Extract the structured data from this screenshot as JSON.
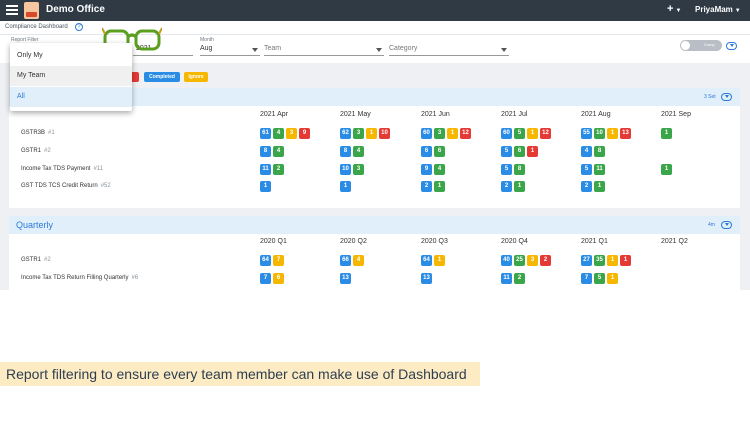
{
  "topbar": {
    "menu_icon": "hamburger-icon",
    "logo_icon": "app-logo-icon",
    "app_title": "Demo Office",
    "add_label": "+",
    "user_name": "PriyaMam"
  },
  "subbar": {
    "breadcrumb": "Compliance Dashboard",
    "help_label": "?"
  },
  "filters": {
    "report_filter_label": "Report Filter",
    "year_value": "2021",
    "month_label": "Month",
    "month_value": "Aug",
    "team_placeholder": "Team",
    "category_placeholder": "Category",
    "toggle_label": "Comp"
  },
  "report_menu": {
    "options": [
      "Only My",
      "My Team",
      "All"
    ],
    "selected": "All"
  },
  "legend": {
    "chips": [
      {
        "label": "",
        "color": "#e53935"
      },
      {
        "label": "Completed",
        "color": "#2a8ce4"
      },
      {
        "label": "Ignore",
        "color": "#f5b700"
      }
    ]
  },
  "monthly": {
    "header_note": "3 Set",
    "columns": [
      "2021 Apr",
      "2021 May",
      "2021 Jun",
      "2021 Jul",
      "2021 Aug",
      "2021 Sep"
    ],
    "rows": [
      {
        "name": "GSTR3B",
        "id": "#1",
        "cells": [
          [
            {
              "v": "61",
              "c": "blue"
            },
            {
              "v": "4",
              "c": "green"
            },
            {
              "v": "3",
              "c": "yellow"
            },
            {
              "v": "9",
              "c": "red"
            }
          ],
          [
            {
              "v": "62",
              "c": "blue"
            },
            {
              "v": "3",
              "c": "green"
            },
            {
              "v": "1",
              "c": "yellow"
            },
            {
              "v": "10",
              "c": "red"
            }
          ],
          [
            {
              "v": "60",
              "c": "blue"
            },
            {
              "v": "3",
              "c": "green"
            },
            {
              "v": "1",
              "c": "yellow"
            },
            {
              "v": "12",
              "c": "red"
            }
          ],
          [
            {
              "v": "60",
              "c": "blue"
            },
            {
              "v": "5",
              "c": "green"
            },
            {
              "v": "1",
              "c": "yellow"
            },
            {
              "v": "12",
              "c": "red"
            }
          ],
          [
            {
              "v": "55",
              "c": "blue"
            },
            {
              "v": "10",
              "c": "green"
            },
            {
              "v": "1",
              "c": "yellow"
            },
            {
              "v": "13",
              "c": "red"
            }
          ],
          [
            {
              "v": "1",
              "c": "green"
            }
          ]
        ]
      },
      {
        "name": "GSTR1",
        "id": "#2",
        "cells": [
          [
            {
              "v": "8",
              "c": "blue"
            },
            {
              "v": "4",
              "c": "green"
            }
          ],
          [
            {
              "v": "8",
              "c": "blue"
            },
            {
              "v": "4",
              "c": "green"
            }
          ],
          [
            {
              "v": "6",
              "c": "blue"
            },
            {
              "v": "6",
              "c": "green"
            }
          ],
          [
            {
              "v": "5",
              "c": "blue"
            },
            {
              "v": "6",
              "c": "green"
            },
            {
              "v": "1",
              "c": "red"
            }
          ],
          [
            {
              "v": "4",
              "c": "blue"
            },
            {
              "v": "8",
              "c": "green"
            }
          ],
          []
        ]
      },
      {
        "name": "Income Tax TDS Payment",
        "id": "#11",
        "cells": [
          [
            {
              "v": "11",
              "c": "blue"
            },
            {
              "v": "2",
              "c": "green"
            }
          ],
          [
            {
              "v": "10",
              "c": "blue"
            },
            {
              "v": "3",
              "c": "green"
            }
          ],
          [
            {
              "v": "9",
              "c": "blue"
            },
            {
              "v": "4",
              "c": "green"
            }
          ],
          [
            {
              "v": "5",
              "c": "blue"
            },
            {
              "v": "8",
              "c": "green"
            }
          ],
          [
            {
              "v": "5",
              "c": "blue"
            },
            {
              "v": "11",
              "c": "green"
            }
          ],
          [
            {
              "v": "1",
              "c": "green"
            }
          ]
        ]
      },
      {
        "name": "GST TDS TCS Credit Return",
        "id": "#52",
        "cells": [
          [
            {
              "v": "1",
              "c": "blue"
            }
          ],
          [
            {
              "v": "1",
              "c": "blue"
            }
          ],
          [
            {
              "v": "2",
              "c": "blue"
            },
            {
              "v": "1",
              "c": "green"
            }
          ],
          [
            {
              "v": "2",
              "c": "blue"
            },
            {
              "v": "1",
              "c": "green"
            }
          ],
          [
            {
              "v": "2",
              "c": "blue"
            },
            {
              "v": "1",
              "c": "green"
            }
          ],
          []
        ]
      }
    ]
  },
  "quarterly": {
    "title": "Quarterly",
    "header_note": "4m",
    "columns": [
      "2020 Q1",
      "2020 Q2",
      "2020 Q3",
      "2020 Q4",
      "2021 Q1",
      "2021 Q2"
    ],
    "rows": [
      {
        "name": "GSTR1",
        "id": "#2",
        "cells": [
          [
            {
              "v": "64",
              "c": "blue"
            },
            {
              "v": "7",
              "c": "yellow"
            }
          ],
          [
            {
              "v": "66",
              "c": "blue"
            },
            {
              "v": "4",
              "c": "yellow"
            }
          ],
          [
            {
              "v": "64",
              "c": "blue"
            },
            {
              "v": "1",
              "c": "yellow"
            }
          ],
          [
            {
              "v": "40",
              "c": "blue"
            },
            {
              "v": "25",
              "c": "green"
            },
            {
              "v": "3",
              "c": "yellow"
            },
            {
              "v": "2",
              "c": "red"
            }
          ],
          [
            {
              "v": "27",
              "c": "blue"
            },
            {
              "v": "35",
              "c": "green"
            },
            {
              "v": "1",
              "c": "yellow"
            },
            {
              "v": "1",
              "c": "red"
            }
          ],
          []
        ]
      },
      {
        "name": "Income Tax TDS Return Filling Quarterly",
        "id": "#6",
        "cells": [
          [
            {
              "v": "7",
              "c": "blue"
            },
            {
              "v": "6",
              "c": "yellow"
            }
          ],
          [
            {
              "v": "13",
              "c": "blue"
            }
          ],
          [
            {
              "v": "13",
              "c": "blue"
            }
          ],
          [
            {
              "v": "11",
              "c": "blue"
            },
            {
              "v": "2",
              "c": "green"
            }
          ],
          [
            {
              "v": "7",
              "c": "blue"
            },
            {
              "v": "5",
              "c": "green"
            },
            {
              "v": "1",
              "c": "yellow"
            }
          ],
          []
        ]
      }
    ]
  },
  "caption": "Report filtering to ensure every team member can make use of Dashboard"
}
